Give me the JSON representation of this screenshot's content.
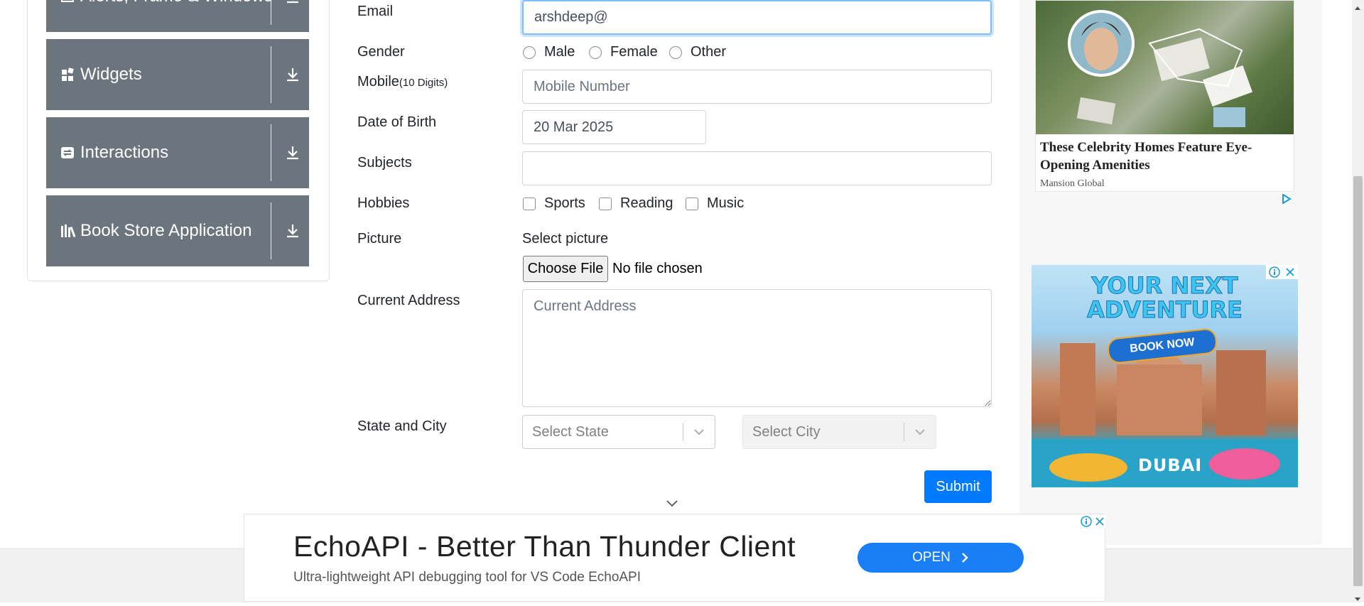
{
  "sidebar": {
    "groups": [
      {
        "label": "Alerts, Frame & Windows",
        "icon": "window-icon"
      },
      {
        "label": "Widgets",
        "icon": "widgets-icon"
      },
      {
        "label": "Interactions",
        "icon": "interactions-icon"
      },
      {
        "label": "Book Store Application",
        "icon": "books-icon"
      }
    ]
  },
  "form": {
    "email": {
      "label": "Email",
      "value": "arshdeep@"
    },
    "gender": {
      "label": "Gender",
      "options": [
        "Male",
        "Female",
        "Other"
      ]
    },
    "mobile": {
      "label": "Mobile",
      "hint": "(10 Digits)",
      "placeholder": "Mobile Number"
    },
    "dob": {
      "label": "Date of Birth",
      "value": "20 Mar 2025"
    },
    "subjects": {
      "label": "Subjects",
      "value": ""
    },
    "hobbies": {
      "label": "Hobbies",
      "options": [
        "Sports",
        "Reading",
        "Music"
      ]
    },
    "picture": {
      "label": "Picture",
      "prompt": "Select picture",
      "button": "Choose File",
      "status": "No file chosen"
    },
    "address": {
      "label": "Current Address",
      "placeholder": "Current Address"
    },
    "state_city": {
      "label": "State and City",
      "state_placeholder": "Select State",
      "city_placeholder": "Select City"
    },
    "submit": "Submit"
  },
  "ads": {
    "right1": {
      "title": "These Celebrity Homes Feature Eye-Opening Amenities",
      "source": "Mansion Global"
    },
    "right2": {
      "line1": "YOUR NEXT",
      "line2": "ADVENTURE",
      "cta": "BOOK NOW",
      "brand": "DUBAI"
    },
    "bottom": {
      "title": "EchoAPI - Better Than Thunder Client",
      "subtitle": "Ultra-lightweight API debugging tool for VS Code EchoAPI",
      "cta": "OPEN"
    }
  },
  "colors": {
    "accent": "#007bff",
    "sidebar_group": "#6c757d",
    "ad_button": "#1a7ef7"
  }
}
